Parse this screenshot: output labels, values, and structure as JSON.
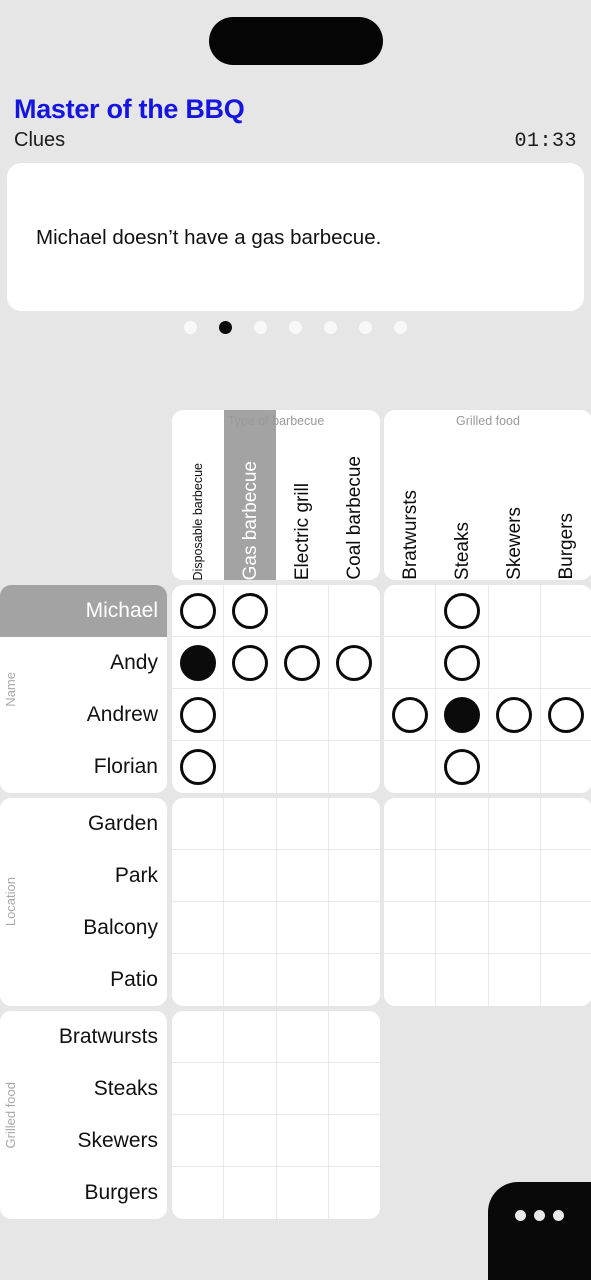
{
  "header": {
    "app_title": "Master of the BBQ",
    "subtitle": "Clues",
    "timer": "01:33"
  },
  "clue": {
    "text": "Michael doesn’t have a gas barbecue.",
    "total_pages": 7,
    "active_page": 2
  },
  "colors": {
    "accent": "#1515e0",
    "background": "#e6e6e6",
    "card": "#ffffff",
    "selected": "#a3a3a3",
    "mark": "#0b0b0b"
  },
  "grid": {
    "column_groups": [
      {
        "title": "Type of barbecue",
        "columns": [
          {
            "label": "Disposable barbecue",
            "small": true,
            "selected": false
          },
          {
            "label": "Gas barbecue",
            "small": false,
            "selected": true
          },
          {
            "label": "Electric grill",
            "small": false,
            "selected": false
          },
          {
            "label": "Coal barbecue",
            "small": false,
            "selected": false
          }
        ]
      },
      {
        "title": "Grilled food",
        "columns": [
          {
            "label": "Bratwursts",
            "small": false,
            "selected": false
          },
          {
            "label": "Steaks",
            "small": false,
            "selected": false
          },
          {
            "label": "Skewers",
            "small": false,
            "selected": false
          },
          {
            "label": "Burgers",
            "small": false,
            "selected": false
          }
        ]
      }
    ],
    "row_groups": [
      {
        "title": "Name",
        "rows": [
          {
            "label": "Michael",
            "selected": true,
            "cells_group1": [
              "open",
              "open",
              "",
              ""
            ],
            "cells_group2": [
              "",
              "open",
              "",
              ""
            ]
          },
          {
            "label": "Andy",
            "selected": false,
            "cells_group1": [
              "filled",
              "open",
              "open",
              "open"
            ],
            "cells_group2": [
              "",
              "open",
              "",
              ""
            ]
          },
          {
            "label": "Andrew",
            "selected": false,
            "cells_group1": [
              "open",
              "",
              "",
              ""
            ],
            "cells_group2": [
              "open",
              "filled",
              "open",
              "open"
            ]
          },
          {
            "label": "Florian",
            "selected": false,
            "cells_group1": [
              "open",
              "",
              "",
              ""
            ],
            "cells_group2": [
              "",
              "open",
              "",
              ""
            ]
          }
        ]
      },
      {
        "title": "Location",
        "rows": [
          {
            "label": "Garden",
            "selected": false,
            "cells_group1": [
              "",
              "",
              "",
              ""
            ],
            "cells_group2": [
              "",
              "",
              "",
              ""
            ]
          },
          {
            "label": "Park",
            "selected": false,
            "cells_group1": [
              "",
              "",
              "",
              ""
            ],
            "cells_group2": [
              "",
              "",
              "",
              ""
            ]
          },
          {
            "label": "Balcony",
            "selected": false,
            "cells_group1": [
              "",
              "",
              "",
              ""
            ],
            "cells_group2": [
              "",
              "",
              "",
              ""
            ]
          },
          {
            "label": "Patio",
            "selected": false,
            "cells_group1": [
              "",
              "",
              "",
              ""
            ],
            "cells_group2": [
              "",
              "",
              "",
              ""
            ]
          }
        ]
      },
      {
        "title": "Grilled food",
        "rows": [
          {
            "label": "Bratwursts",
            "selected": false,
            "cells_group1": [
              "",
              "",
              "",
              ""
            ],
            "cells_group2": null
          },
          {
            "label": "Steaks",
            "selected": false,
            "cells_group1": [
              "",
              "",
              "",
              ""
            ],
            "cells_group2": null
          },
          {
            "label": "Skewers",
            "selected": false,
            "cells_group1": [
              "",
              "",
              "",
              ""
            ],
            "cells_group2": null
          },
          {
            "label": "Burgers",
            "selected": false,
            "cells_group1": [
              "",
              "",
              "",
              ""
            ],
            "cells_group2": null
          }
        ]
      }
    ]
  },
  "fab": {
    "icon": "more-horizontal-icon"
  }
}
